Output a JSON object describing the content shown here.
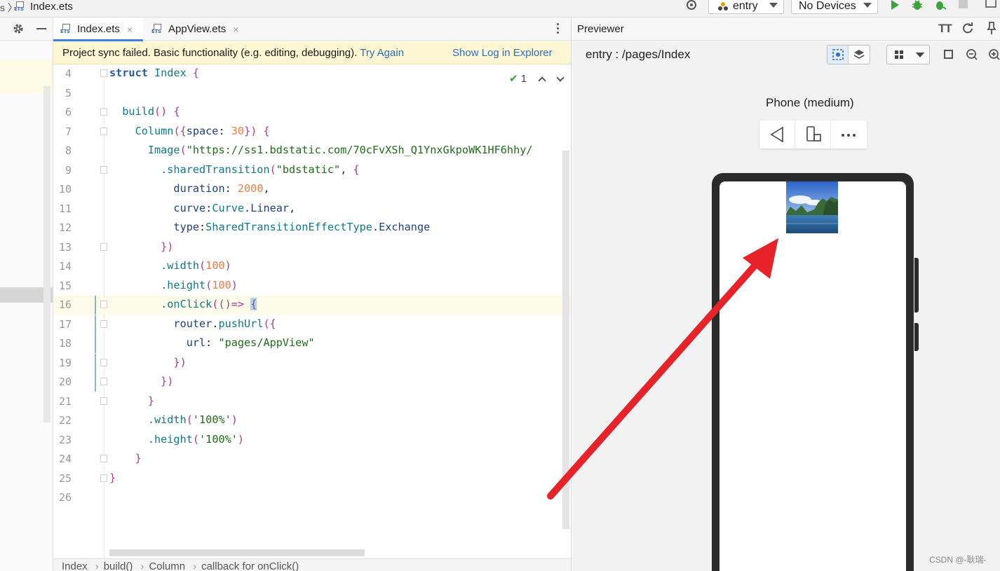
{
  "topbar": {
    "separator": "s 〉",
    "file_name": "Index.ets",
    "run_config": "entry",
    "device_select": "No Devices"
  },
  "editor": {
    "tabs": [
      {
        "label": "Index.ets",
        "icon_text": "ETS",
        "active": true
      },
      {
        "label": "AppView.ets",
        "icon_text": "ETS",
        "active": false
      }
    ],
    "tab_close": "×",
    "banner": {
      "message": "Project sync failed. Basic functionality (e.g. editing, debugging).",
      "try_again": "Try Again",
      "show_log": "Show Log in Explorer"
    },
    "inspection": {
      "check": "✔",
      "count": "1"
    },
    "lines": [
      {
        "n": "4",
        "tokens": [
          [
            "kw",
            "struct "
          ],
          [
            "k",
            "Index "
          ],
          [
            "p",
            "{"
          ]
        ]
      },
      {
        "n": "5",
        "tokens": []
      },
      {
        "n": "6",
        "tokens": [
          [
            "k",
            "  build"
          ],
          [
            "p",
            "() {"
          ]
        ]
      },
      {
        "n": "7",
        "tokens": [
          [
            "k",
            "    Column"
          ],
          [
            "p",
            "({"
          ],
          [
            "prop",
            "space"
          ],
          [
            "pl",
            ": "
          ],
          [
            "n",
            "30"
          ],
          [
            "p",
            "}) {"
          ]
        ]
      },
      {
        "n": "8",
        "tokens": [
          [
            "k",
            "      Image"
          ],
          [
            "p",
            "("
          ],
          [
            "s",
            "\"https://ss1.bdstatic.com/70cFvXSh_Q1YnxGkpoWK1HF6hhy/"
          ]
        ]
      },
      {
        "n": "9",
        "tokens": [
          [
            "k",
            "        .sharedTransition"
          ],
          [
            "p",
            "("
          ],
          [
            "s",
            "\"bdstatic\""
          ],
          [
            "pl",
            ", "
          ],
          [
            "p",
            "{"
          ]
        ]
      },
      {
        "n": "10",
        "tokens": [
          [
            "prop",
            "          duration"
          ],
          [
            "pl",
            ": "
          ],
          [
            "n",
            "2000"
          ],
          [
            "pl",
            ","
          ]
        ]
      },
      {
        "n": "11",
        "tokens": [
          [
            "prop",
            "          curve"
          ],
          [
            "pl",
            ":"
          ],
          [
            "k",
            "Curve"
          ],
          [
            "pl",
            "."
          ],
          [
            "prop",
            "Linear"
          ],
          [
            "pl",
            ","
          ]
        ]
      },
      {
        "n": "12",
        "tokens": [
          [
            "prop",
            "          type"
          ],
          [
            "pl",
            ":"
          ],
          [
            "k",
            "SharedTransitionEffectType"
          ],
          [
            "pl",
            "."
          ],
          [
            "prop",
            "Exchange"
          ]
        ]
      },
      {
        "n": "13",
        "tokens": [
          [
            "p",
            "        })"
          ]
        ]
      },
      {
        "n": "14",
        "tokens": [
          [
            "k",
            "        .width"
          ],
          [
            "p",
            "("
          ],
          [
            "n",
            "100"
          ],
          [
            "p",
            ")"
          ]
        ]
      },
      {
        "n": "15",
        "tokens": [
          [
            "k",
            "        .height"
          ],
          [
            "p",
            "("
          ],
          [
            "n",
            "100"
          ],
          [
            "p",
            ")"
          ]
        ]
      },
      {
        "n": "16",
        "tokens": [
          [
            "k",
            "        .onClick"
          ],
          [
            "p",
            "(()=>"
          ],
          [
            "pl",
            " "
          ],
          [
            "p",
            "{"
          ]
        ],
        "current": true
      },
      {
        "n": "17",
        "tokens": [
          [
            "prop",
            "          router"
          ],
          [
            "pl",
            "."
          ],
          [
            "k",
            "pushUrl"
          ],
          [
            "p",
            "({"
          ]
        ]
      },
      {
        "n": "18",
        "tokens": [
          [
            "prop",
            "            url"
          ],
          [
            "pl",
            ": "
          ],
          [
            "s",
            "\"pages/AppView\""
          ]
        ]
      },
      {
        "n": "19",
        "tokens": [
          [
            "p",
            "          })"
          ]
        ]
      },
      {
        "n": "20",
        "tokens": [
          [
            "p",
            "        })"
          ]
        ]
      },
      {
        "n": "21",
        "tokens": [
          [
            "p",
            "      }"
          ]
        ]
      },
      {
        "n": "22",
        "tokens": [
          [
            "k",
            "      .width"
          ],
          [
            "p",
            "("
          ],
          [
            "s",
            "'100%'"
          ],
          [
            "p",
            ")"
          ]
        ]
      },
      {
        "n": "23",
        "tokens": [
          [
            "k",
            "      .height"
          ],
          [
            "p",
            "("
          ],
          [
            "s",
            "'100%'"
          ],
          [
            "p",
            ")"
          ]
        ]
      },
      {
        "n": "24",
        "tokens": [
          [
            "p",
            "    }"
          ]
        ]
      },
      {
        "n": "25",
        "tokens": [
          [
            "p",
            "}"
          ]
        ]
      },
      {
        "n": "26",
        "tokens": []
      }
    ],
    "breadcrumb": [
      "Index",
      "build()",
      "Column",
      "callback for onClick()"
    ],
    "breadcrumb_sep": "›"
  },
  "previewer": {
    "title": "Previewer",
    "font_button": "TT",
    "route": "entry : /pages/Index",
    "device_name": "Phone (medium)",
    "watermark": "CSDN @-耿瑞-"
  },
  "colors": {
    "annotation_arrow": "#e52329",
    "accent": "#3d7fe0",
    "run_green": "#3aa33a",
    "banner_bg": "#fdf6d2"
  },
  "icons": [
    "settings-icon",
    "run-icon",
    "debug-icon",
    "close-icon",
    "more-icon",
    "back-icon",
    "rotate-icon",
    "refresh-icon",
    "pin-icon",
    "zoom-in-icon",
    "zoom-out-icon",
    "layers-icon",
    "grid-icon"
  ]
}
